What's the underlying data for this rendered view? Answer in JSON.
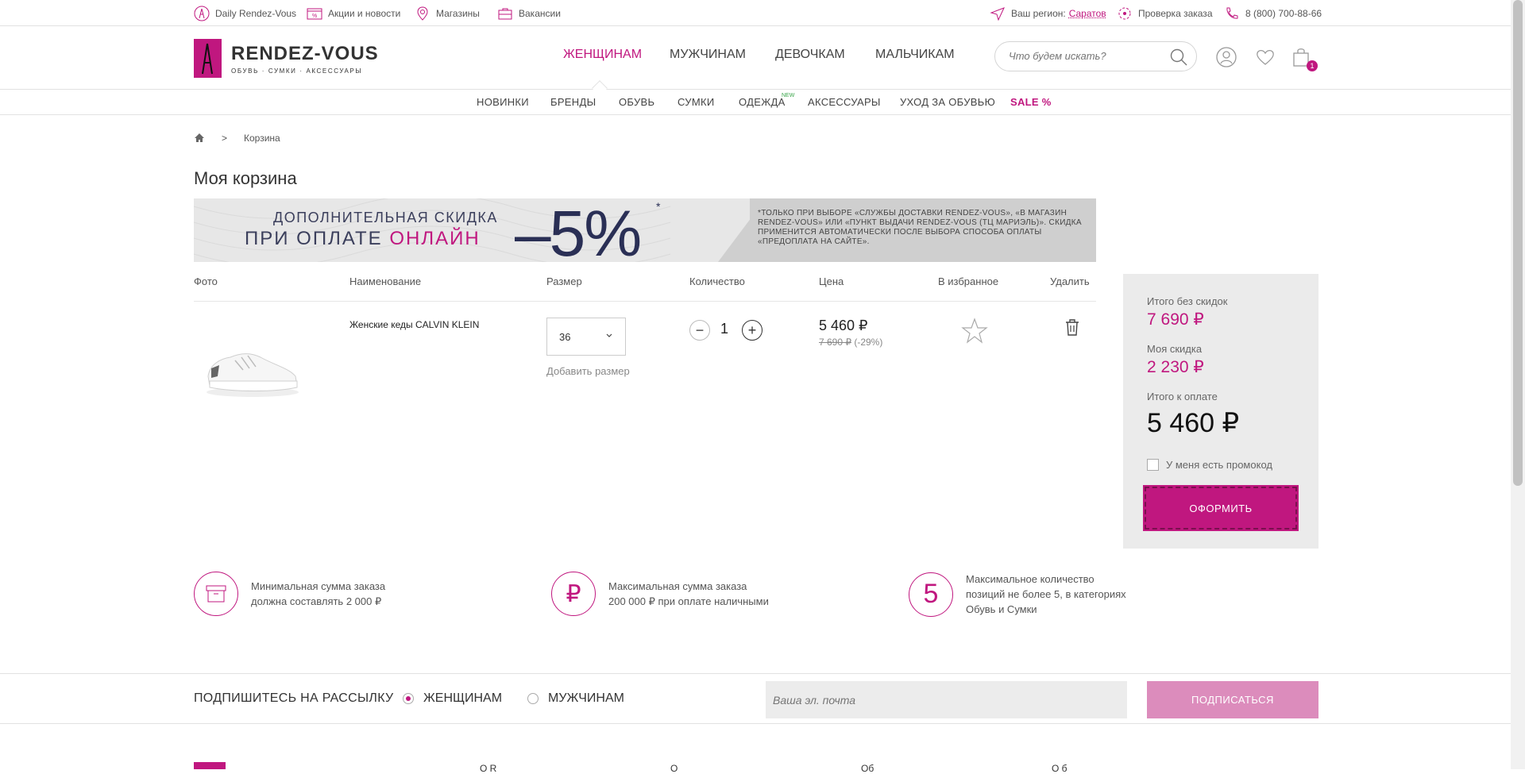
{
  "topbar": {
    "daily": "Daily Rendez-Vous",
    "promo": "Акции и новости",
    "stores": "Магазины",
    "jobs": "Вакансии",
    "region_label": "Ваш регион:",
    "region_value": "Саратов",
    "order_check": "Проверка заказа",
    "phone": "8 (800) 700-88-66"
  },
  "logo": {
    "title": "RENDEZ-VOUS",
    "subtitle": "ОБУВЬ · СУМКИ · АКСЕССУАРЫ",
    "box_text": "Rendez-Vous"
  },
  "main_nav": [
    "ЖЕНЩИНАМ",
    "МУЖЧИНАМ",
    "ДЕВОЧКАМ",
    "МАЛЬЧИКАМ"
  ],
  "search": {
    "placeholder": "Что будем искать?"
  },
  "cart_count": "1",
  "sub_nav": [
    "НОВИНКИ",
    "БРЕНДЫ",
    "ОБУВЬ",
    "СУМКИ",
    "ОДЕЖДА",
    "АКСЕССУАРЫ",
    "УХОД ЗА ОБУВЬЮ",
    "SALE %"
  ],
  "new_tag": "NEW",
  "breadcrumb": {
    "separator": ">",
    "current": "Корзина"
  },
  "page_title": "Моя корзина",
  "banner": {
    "line1": "ДОПОЛНИТЕЛЬНАЯ СКИДКА",
    "line2_prefix": "ПРИ ОПЛАТЕ ",
    "line2_accent": "ОНЛАЙН",
    "discount": "–5%",
    "asterisk": "*",
    "note": "*ТОЛЬКО ПРИ ВЫБОРЕ «СЛУЖБЫ ДОСТАВКИ RENDEZ-VOUS», «В МАГАЗИН RENDEZ-VOUS» ИЛИ «ПУНКТ ВЫДАЧИ RENDEZ-VOUS (ТЦ МАРИЭЛЬ)». СКИДКА ПРИМЕНИТСЯ АВТОМАТИЧЕСКИ ПОСЛЕ ВЫБОРА СПОСОБА ОПЛАТЫ «ПРЕДОПЛАТА НА САЙТЕ»."
  },
  "table_headers": {
    "photo": "Фото",
    "name": "Наименование",
    "size": "Размер",
    "quantity": "Количество",
    "price": "Цена",
    "favorite": "В избранное",
    "delete": "Удалить"
  },
  "item": {
    "name": "Женские кеды CALVIN KLEIN",
    "size": "36",
    "add_size": "Добавить размер",
    "qty_minus": "−",
    "qty": "1",
    "qty_plus": "+",
    "price": "5 460 ₽",
    "old_price": "7 690 ₽",
    "discount": " (-29%)"
  },
  "summary": {
    "no_discount_label": "Итого без скидок",
    "no_discount_value": "7 690 ₽",
    "discount_label": "Моя скидка",
    "discount_value": "2 230 ₽",
    "total_label": "Итого к оплате",
    "total_value": "5 460 ₽",
    "promo_label": "У меня есть промокод",
    "order_button": "ОФОРМИТЬ"
  },
  "info": [
    {
      "icon": "box-icon",
      "line1": "Минимальная сумма заказа",
      "line2": "должна составлять 2 000 ₽"
    },
    {
      "icon": "ruble-icon",
      "glyph": "₽",
      "line1": "Максимальная сумма заказа",
      "line2": "200 000 ₽ при оплате наличными"
    },
    {
      "icon": "five-icon",
      "glyph": "5",
      "line1": "Максимальное количество",
      "line2": "позиций не более 5, в категориях",
      "line3": "Обувь и Сумки"
    }
  ],
  "subscribe": {
    "title": "ПОДПИШИТЕСЬ НА РАССЫЛКУ",
    "women": "ЖЕНЩИНАМ",
    "men": "МУЖЧИНАМ",
    "email_placeholder": "Ваша эл. почта",
    "button": "ПОДПИСАТЬСЯ"
  },
  "footer_peek": [
    "О R",
    "О",
    "Об",
    "О б"
  ],
  "colors": {
    "accent": "#c0177f",
    "accent_light": "#dc8cbc",
    "summary_bg": "#ebebeb"
  }
}
